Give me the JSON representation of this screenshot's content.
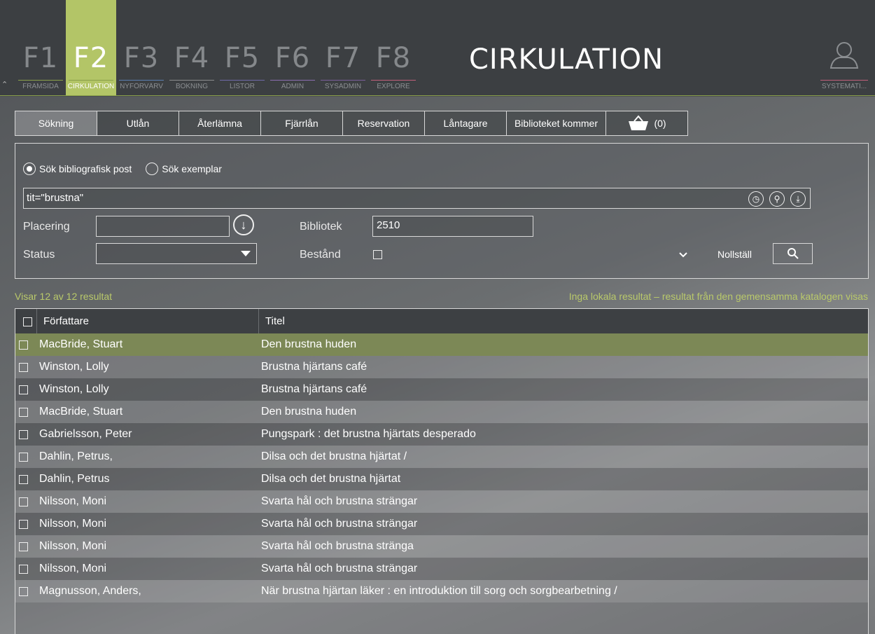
{
  "header": {
    "app_title": "CIRKULATION",
    "fkeys": [
      {
        "key": "F1",
        "label": "FRAMSIDA",
        "line_color": "#8aa04a"
      },
      {
        "key": "F2",
        "label": "CIRKULATION",
        "line_color": "#8aa04a"
      },
      {
        "key": "F3",
        "label": "NYFÖRVÄRV",
        "line_color": "#5a7fb0"
      },
      {
        "key": "F4",
        "label": "BOKNING",
        "line_color": "#8a8c8e"
      },
      {
        "key": "F5",
        "label": "LISTOR",
        "line_color": "#6f6aa8"
      },
      {
        "key": "F6",
        "label": "ADMIN",
        "line_color": "#8a6db0"
      },
      {
        "key": "F7",
        "label": "SYSADMIN",
        "line_color": "#7a5d9a"
      },
      {
        "key": "F8",
        "label": "EXPLORE",
        "line_color": "#c0607a"
      }
    ],
    "active_index": 1,
    "user_label": "SYSTEMATI..."
  },
  "tabs": [
    {
      "label": "Sökning"
    },
    {
      "label": "Utlån"
    },
    {
      "label": "Återlämna"
    },
    {
      "label": "Fjärrlån"
    },
    {
      "label": "Reservation"
    },
    {
      "label": "Låntagare"
    },
    {
      "label": "Biblioteket kommer"
    }
  ],
  "basket_count": "(0)",
  "search": {
    "radio_biblio": "Sök bibliografisk post",
    "radio_exemplar": "Sök exemplar",
    "query": "tit=\"brustna\"",
    "placering_label": "Placering",
    "placering_value": "",
    "bibliotek_label": "Bibliotek",
    "bibliotek_value": "2510",
    "status_label": "Status",
    "status_value": "",
    "bestand_label": "Bestånd",
    "reset_label": "Nollställ"
  },
  "results": {
    "count_text": "Visar 12 av 12 resultat",
    "notice": "Inga lokala resultat – resultat från den gemensamma katalogen visas",
    "columns": {
      "author": "Författare",
      "title": "Titel"
    },
    "rows": [
      {
        "author": "MacBride, Stuart",
        "title": "Den brustna huden"
      },
      {
        "author": "Winston, Lolly",
        "title": "Brustna hjärtans café"
      },
      {
        "author": "Winston, Lolly",
        "title": "Brustna hjärtans café"
      },
      {
        "author": "MacBride, Stuart",
        "title": "Den brustna huden"
      },
      {
        "author": "Gabrielsson, Peter",
        "title": "Pungspark : det brustna hjärtats desperado"
      },
      {
        "author": "Dahlin, Petrus,",
        "title": "Dilsa och det brustna hjärtat /"
      },
      {
        "author": "Dahlin, Petrus",
        "title": "Dilsa och det brustna hjärtat"
      },
      {
        "author": "Nilsson, Moni",
        "title": "Svarta hål och brustna strängar"
      },
      {
        "author": "Nilsson, Moni",
        "title": "Svarta hål och brustna strängar"
      },
      {
        "author": "Nilsson, Moni",
        "title": "Svarta hål och brustna stränga"
      },
      {
        "author": "Nilsson, Moni",
        "title": "Svarta hål och brustna strängar"
      },
      {
        "author": "Magnusson, Anders,",
        "title": "När brustna hjärtan läker : en introduktion till sorg och sorgbearbetning /"
      }
    ]
  }
}
